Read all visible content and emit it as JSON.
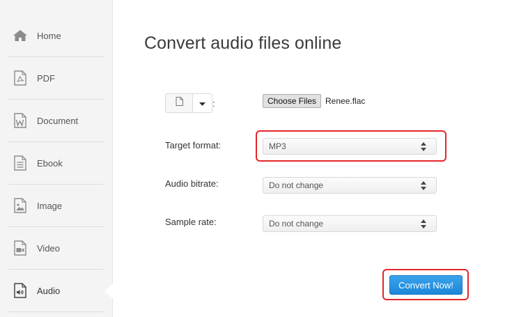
{
  "sidebar": {
    "items": [
      {
        "label": "Home",
        "icon": "home-icon"
      },
      {
        "label": "PDF",
        "icon": "pdf-file-icon"
      },
      {
        "label": "Document",
        "icon": "word-document-icon"
      },
      {
        "label": "Ebook",
        "icon": "ebook-icon"
      },
      {
        "label": "Image",
        "icon": "image-file-icon"
      },
      {
        "label": "Video",
        "icon": "video-file-icon"
      },
      {
        "label": "Audio",
        "icon": "audio-file-icon",
        "active": true
      }
    ]
  },
  "main": {
    "title": "Convert audio files online",
    "file_input": {
      "colon": ":",
      "choose_label": "Choose Files",
      "file_name": "Renee.flac"
    },
    "target_format": {
      "label": "Target format:",
      "value": "MP3"
    },
    "audio_bitrate": {
      "label": "Audio bitrate:",
      "value": "Do not change"
    },
    "sample_rate": {
      "label": "Sample rate:",
      "value": "Do not change"
    },
    "convert_button": "Convert Now!"
  },
  "colors": {
    "accent": "#1d86d8",
    "highlight": "#e4262a",
    "sidebar_bg": "#f4f4f4"
  }
}
